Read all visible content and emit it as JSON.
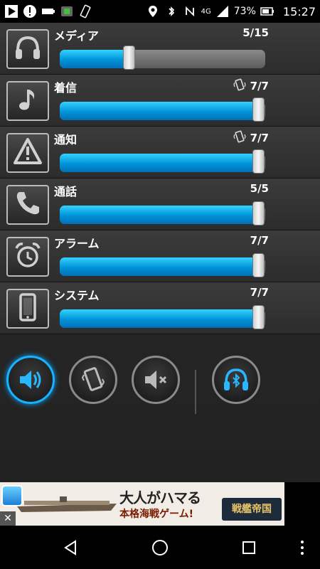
{
  "status_bar": {
    "network": "4G",
    "battery": "73%",
    "time": "15:27"
  },
  "channels": [
    {
      "key": "media",
      "label": "メディア",
      "value_text": "5/15",
      "level": 0.33,
      "vibrate_icon": false,
      "icon": "headphones-icon"
    },
    {
      "key": "ringtone",
      "label": "着信",
      "value_text": "7/7",
      "level": 1.0,
      "vibrate_icon": true,
      "icon": "music-note-icon"
    },
    {
      "key": "notification",
      "label": "通知",
      "value_text": "7/7",
      "level": 1.0,
      "vibrate_icon": true,
      "icon": "warning-icon"
    },
    {
      "key": "call",
      "label": "通話",
      "value_text": "5/5",
      "level": 1.0,
      "vibrate_icon": false,
      "icon": "phone-icon"
    },
    {
      "key": "alarm",
      "label": "アラーム",
      "value_text": "7/7",
      "level": 1.0,
      "vibrate_icon": false,
      "icon": "alarm-clock-icon"
    },
    {
      "key": "system",
      "label": "システム",
      "value_text": "7/7",
      "level": 1.0,
      "vibrate_icon": false,
      "icon": "smartphone-icon"
    }
  ],
  "modes": {
    "active": "sound",
    "items": [
      "sound",
      "vibrate",
      "mute",
      "bluetooth"
    ]
  },
  "ad": {
    "headline": "大人がハマる",
    "sub": "本格海戦ゲーム!",
    "brand": "戦艦帝国",
    "close": "✕"
  },
  "colors": {
    "accent": "#17b3ff",
    "fill": "#0093d8"
  }
}
